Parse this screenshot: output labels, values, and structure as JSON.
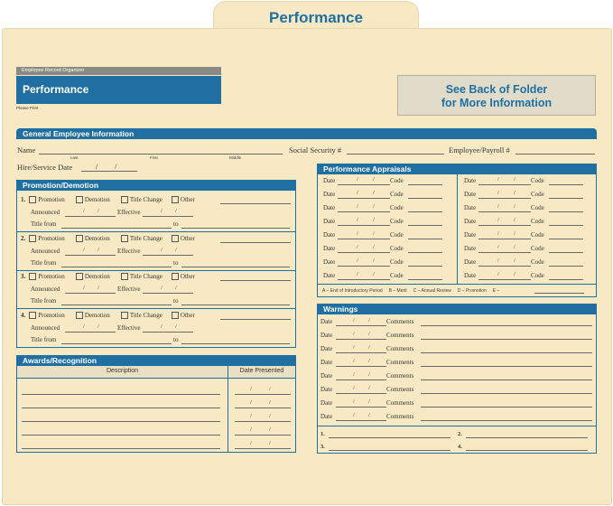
{
  "tab": {
    "title": "Performance"
  },
  "header": {
    "organizer_label": "Employee Record Organizer",
    "organizer_title": "Performance",
    "please_print": "Please Print",
    "see_back_line1": "See Back of Folder",
    "see_back_line2": "for More Information"
  },
  "general": {
    "title": "General Employee Information",
    "name": "Name",
    "last": "Last",
    "first": "First",
    "middle": "Middle",
    "ssn": "Social Security #",
    "payroll": "Employee/Payroll #",
    "hire": "Hire/Service Date",
    "slash": "/"
  },
  "promotion": {
    "title": "Promotion/Demotion",
    "nums": [
      "1.",
      "2.",
      "3.",
      "4."
    ],
    "opt_promotion": "Promotion",
    "opt_demotion": "Demotion",
    "opt_title_change": "Title Change",
    "opt_other": "Other",
    "announced": "Announced",
    "effective": "Effective",
    "title_from": "Title from",
    "to": "to"
  },
  "awards": {
    "title": "Awards/Recognition",
    "col_description": "Description",
    "col_date_presented": "Date Presented"
  },
  "appraisals": {
    "title": "Performance Appraisals",
    "date": "Date",
    "code": "Code",
    "legend": "A – End of Introductory Period     B – Merit     C – Annual Review     D – Promotion     E – "
  },
  "warnings": {
    "title": "Warnings",
    "date": "Date",
    "comments": "Comments",
    "footer_nums": [
      "1.",
      "2.",
      "3.",
      "4."
    ]
  }
}
